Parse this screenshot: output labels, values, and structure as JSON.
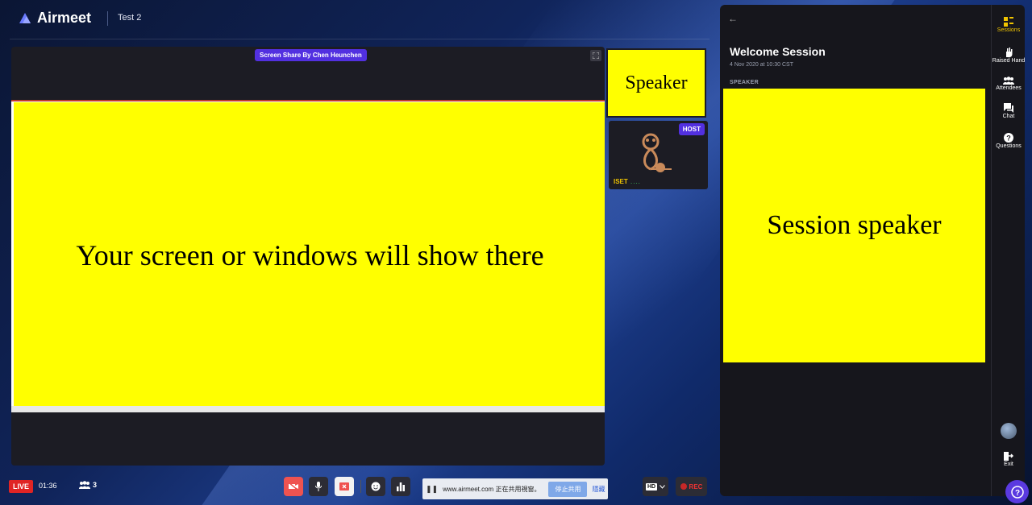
{
  "header": {
    "brand": "Airmeet",
    "event_name": "Test 2"
  },
  "stage": {
    "share_tag": "Screen Share By Chen Heunchen",
    "screen_message": "Your screen or windows will show there"
  },
  "tiles": {
    "speaker_label": "Speaker",
    "host_badge": "HOST",
    "host_name": "ISET"
  },
  "panel": {
    "title": "Welcome Session",
    "date": "4 Nov 2020 at 10:30 CST",
    "speaker_heading": "SPEAKER",
    "speaker_box_text": "Session speaker"
  },
  "rail": {
    "items": [
      {
        "label": "Sessions",
        "icon": "sessions-icon",
        "active": true
      },
      {
        "label": "Raised Hand",
        "icon": "hand-icon"
      },
      {
        "label": "Attendees",
        "icon": "attendees-icon"
      },
      {
        "label": "Chat",
        "icon": "chat-icon"
      },
      {
        "label": "Questions",
        "icon": "questions-icon"
      }
    ],
    "exit_label": "Exit"
  },
  "bottom": {
    "live_label": "LIVE",
    "timer": "01:36",
    "people_count": "3",
    "share_message": "www.airmeet.com 正在共用視窗。",
    "stop_share_label": "停止共用",
    "hide_label": "隱藏",
    "hd_label": "HD",
    "rec_label": "REC"
  },
  "colors": {
    "accent": "#5230e0",
    "highlight": "#ffff00",
    "active": "#f0c400",
    "live": "#e02424"
  }
}
